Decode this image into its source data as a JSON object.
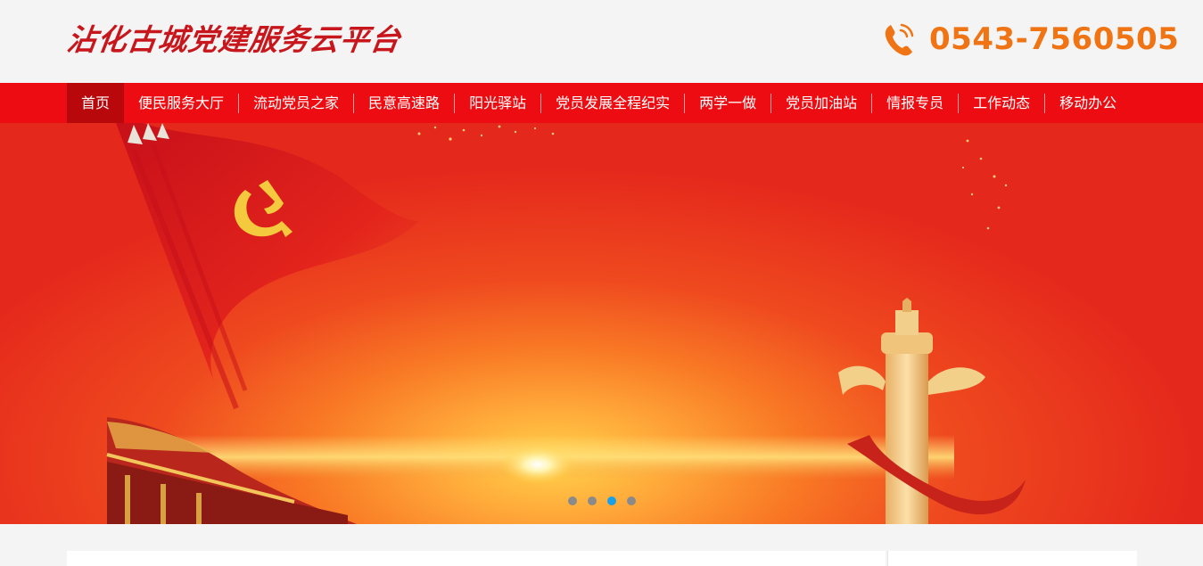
{
  "header": {
    "site_title": "沾化古城党建服务云平台",
    "hotline_icon": "phone-icon",
    "hotline": "0543-7560505"
  },
  "nav": {
    "items": [
      {
        "label": "首页",
        "active": true
      },
      {
        "label": "便民服务大厅"
      },
      {
        "label": "流动党员之家"
      },
      {
        "label": "民意高速路"
      },
      {
        "label": "阳光驿站"
      },
      {
        "label": "党员发展全程纪实"
      },
      {
        "label": "两学一做"
      },
      {
        "label": "党员加油站"
      },
      {
        "label": "情报专员"
      },
      {
        "label": "工作动态"
      },
      {
        "label": "移动办公"
      }
    ]
  },
  "banner": {
    "slide_count": 4,
    "active_slide": 3
  },
  "colors": {
    "nav_bg": "#ec0c11",
    "nav_active": "#b8080b",
    "hotline": "#f07414",
    "title": "#c8161d",
    "dot_active": "#1aa0e6"
  }
}
